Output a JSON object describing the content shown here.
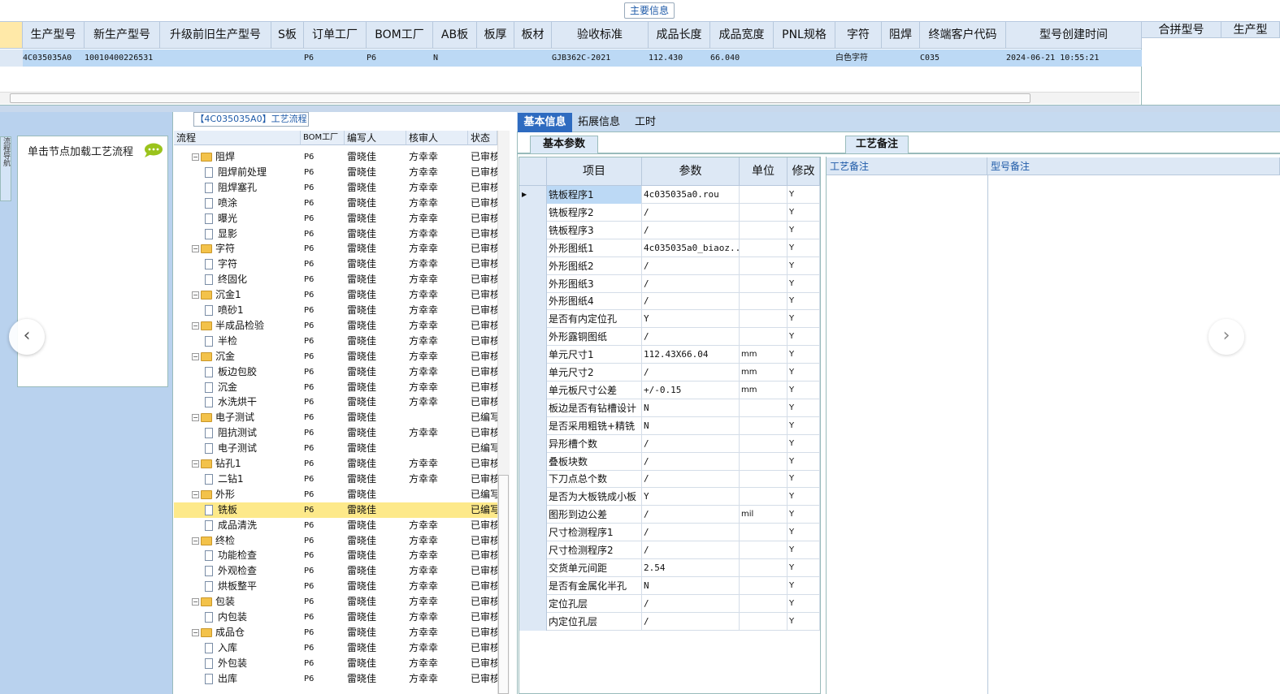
{
  "top_caption": "主要信息",
  "master": {
    "headers": [
      "生产型号",
      "新生产型号",
      "升级前旧生产型号",
      "S板",
      "订单工厂",
      "BOM工厂",
      "AB板",
      "板厚",
      "板材",
      "验收标准",
      "成品长度",
      "成品宽度",
      "PNL规格",
      "字符",
      "阻焊",
      "终端客户代码",
      "型号创建时间"
    ],
    "row": [
      "4C035035A0",
      "10010400226531",
      "",
      "",
      "P6",
      "P6",
      "N",
      "",
      "",
      "GJB362C-2021",
      "112.430",
      "66.040",
      "",
      "白色字符",
      "",
      "C035",
      "2024-06-21 10:55:21"
    ]
  },
  "merge_headers": [
    "合拼型号",
    "生产型"
  ],
  "side_tab": "流程导航",
  "node_hint": "单击节点加载工艺流程",
  "tree": {
    "title": "【4C035035A0】工艺流程",
    "headers": [
      "流程",
      "BOM工厂",
      "编写人",
      "核审人",
      "状态"
    ],
    "rows": [
      {
        "level": 0,
        "type": "folder",
        "name": "阻焊",
        "bom": "P6",
        "writer": "雷晓佳",
        "reviewer": "方幸幸",
        "status": "已审核"
      },
      {
        "level": 1,
        "type": "doc",
        "name": "阻焊前处理",
        "bom": "P6",
        "writer": "雷晓佳",
        "reviewer": "方幸幸",
        "status": "已审核"
      },
      {
        "level": 1,
        "type": "doc",
        "name": "阻焊塞孔",
        "bom": "P6",
        "writer": "雷晓佳",
        "reviewer": "方幸幸",
        "status": "已审核"
      },
      {
        "level": 1,
        "type": "doc",
        "name": "喷涂",
        "bom": "P6",
        "writer": "雷晓佳",
        "reviewer": "方幸幸",
        "status": "已审核"
      },
      {
        "level": 1,
        "type": "doc",
        "name": "曝光",
        "bom": "P6",
        "writer": "雷晓佳",
        "reviewer": "方幸幸",
        "status": "已审核"
      },
      {
        "level": 1,
        "type": "doc",
        "name": "显影",
        "bom": "P6",
        "writer": "雷晓佳",
        "reviewer": "方幸幸",
        "status": "已审核"
      },
      {
        "level": 0,
        "type": "folder",
        "name": "字符",
        "bom": "P6",
        "writer": "雷晓佳",
        "reviewer": "方幸幸",
        "status": "已审核"
      },
      {
        "level": 1,
        "type": "doc",
        "name": "字符",
        "bom": "P6",
        "writer": "雷晓佳",
        "reviewer": "方幸幸",
        "status": "已审核"
      },
      {
        "level": 1,
        "type": "doc",
        "name": "终固化",
        "bom": "P6",
        "writer": "雷晓佳",
        "reviewer": "方幸幸",
        "status": "已审核"
      },
      {
        "level": 0,
        "type": "folder",
        "name": "沉金1",
        "bom": "P6",
        "writer": "雷晓佳",
        "reviewer": "方幸幸",
        "status": "已审核"
      },
      {
        "level": 1,
        "type": "doc",
        "name": "喷砂1",
        "bom": "P6",
        "writer": "雷晓佳",
        "reviewer": "方幸幸",
        "status": "已审核"
      },
      {
        "level": 0,
        "type": "folder",
        "name": "半成品检验",
        "bom": "P6",
        "writer": "雷晓佳",
        "reviewer": "方幸幸",
        "status": "已审核"
      },
      {
        "level": 1,
        "type": "doc",
        "name": "半检",
        "bom": "P6",
        "writer": "雷晓佳",
        "reviewer": "方幸幸",
        "status": "已审核"
      },
      {
        "level": 0,
        "type": "folder",
        "name": "沉金",
        "bom": "P6",
        "writer": "雷晓佳",
        "reviewer": "方幸幸",
        "status": "已审核"
      },
      {
        "level": 1,
        "type": "doc",
        "name": "板边包胶",
        "bom": "P6",
        "writer": "雷晓佳",
        "reviewer": "方幸幸",
        "status": "已审核"
      },
      {
        "level": 1,
        "type": "doc",
        "name": "沉金",
        "bom": "P6",
        "writer": "雷晓佳",
        "reviewer": "方幸幸",
        "status": "已审核"
      },
      {
        "level": 1,
        "type": "doc",
        "name": "水洗烘干",
        "bom": "P6",
        "writer": "雷晓佳",
        "reviewer": "方幸幸",
        "status": "已审核"
      },
      {
        "level": 0,
        "type": "folder",
        "name": "电子测试",
        "bom": "P6",
        "writer": "雷晓佳",
        "reviewer": "",
        "status": "已编写"
      },
      {
        "level": 1,
        "type": "doc",
        "name": "阻抗测试",
        "bom": "P6",
        "writer": "雷晓佳",
        "reviewer": "方幸幸",
        "status": "已审核"
      },
      {
        "level": 1,
        "type": "doc",
        "name": "电子测试",
        "bom": "P6",
        "writer": "雷晓佳",
        "reviewer": "",
        "status": "已编写"
      },
      {
        "level": 0,
        "type": "folder",
        "name": "钻孔1",
        "bom": "P6",
        "writer": "雷晓佳",
        "reviewer": "方幸幸",
        "status": "已审核"
      },
      {
        "level": 1,
        "type": "doc",
        "name": "二钻1",
        "bom": "P6",
        "writer": "雷晓佳",
        "reviewer": "方幸幸",
        "status": "已审核"
      },
      {
        "level": 0,
        "type": "folder",
        "name": "外形",
        "bom": "P6",
        "writer": "雷晓佳",
        "reviewer": "",
        "status": "已编写"
      },
      {
        "level": 1,
        "type": "doc",
        "name": "铣板",
        "bom": "P6",
        "writer": "雷晓佳",
        "reviewer": "",
        "status": "已编写",
        "selected": true
      },
      {
        "level": 1,
        "type": "doc",
        "name": "成品清洗",
        "bom": "P6",
        "writer": "雷晓佳",
        "reviewer": "方幸幸",
        "status": "已审核"
      },
      {
        "level": 0,
        "type": "folder",
        "name": "终检",
        "bom": "P6",
        "writer": "雷晓佳",
        "reviewer": "方幸幸",
        "status": "已审核"
      },
      {
        "level": 1,
        "type": "doc",
        "name": "功能检查",
        "bom": "P6",
        "writer": "雷晓佳",
        "reviewer": "方幸幸",
        "status": "已审核"
      },
      {
        "level": 1,
        "type": "doc",
        "name": "外观检查",
        "bom": "P6",
        "writer": "雷晓佳",
        "reviewer": "方幸幸",
        "status": "已审核"
      },
      {
        "level": 1,
        "type": "doc",
        "name": "烘板整平",
        "bom": "P6",
        "writer": "雷晓佳",
        "reviewer": "方幸幸",
        "status": "已审核"
      },
      {
        "level": 0,
        "type": "folder",
        "name": "包装",
        "bom": "P6",
        "writer": "雷晓佳",
        "reviewer": "方幸幸",
        "status": "已审核"
      },
      {
        "level": 1,
        "type": "doc",
        "name": "内包装",
        "bom": "P6",
        "writer": "雷晓佳",
        "reviewer": "方幸幸",
        "status": "已审核"
      },
      {
        "level": 0,
        "type": "folder",
        "name": "成品仓",
        "bom": "P6",
        "writer": "雷晓佳",
        "reviewer": "方幸幸",
        "status": "已审核"
      },
      {
        "level": 1,
        "type": "doc",
        "name": "入库",
        "bom": "P6",
        "writer": "雷晓佳",
        "reviewer": "方幸幸",
        "status": "已审核"
      },
      {
        "level": 1,
        "type": "doc",
        "name": "外包装",
        "bom": "P6",
        "writer": "雷晓佳",
        "reviewer": "方幸幸",
        "status": "已审核"
      },
      {
        "level": 1,
        "type": "doc",
        "name": "出库",
        "bom": "P6",
        "writer": "雷晓佳",
        "reviewer": "方幸幸",
        "status": "已审核"
      }
    ]
  },
  "tabs": [
    "基本信息",
    "拓展信息",
    "工时"
  ],
  "basic_params_tab": "基本参数",
  "remark_tab": "工艺备注",
  "params": {
    "headers": [
      "项目",
      "参数",
      "单位",
      "修改"
    ],
    "rows": [
      {
        "item": "铣板程序1",
        "param": "4c035035a0.rou",
        "unit": "",
        "mod": "Y"
      },
      {
        "item": "铣板程序2",
        "param": "/",
        "unit": "",
        "mod": "Y"
      },
      {
        "item": "铣板程序3",
        "param": "/",
        "unit": "",
        "mod": "Y"
      },
      {
        "item": "外形图纸1",
        "param": "4c035035a0_biaoz...",
        "unit": "",
        "mod": "Y"
      },
      {
        "item": "外形图纸2",
        "param": "/",
        "unit": "",
        "mod": "Y"
      },
      {
        "item": "外形图纸3",
        "param": "/",
        "unit": "",
        "mod": "Y"
      },
      {
        "item": "外形图纸4",
        "param": "/",
        "unit": "",
        "mod": "Y"
      },
      {
        "item": "是否有内定位孔",
        "param": "Y",
        "unit": "",
        "mod": "Y"
      },
      {
        "item": "外形露铜图纸",
        "param": "/",
        "unit": "",
        "mod": "Y"
      },
      {
        "item": "单元尺寸1",
        "param": "112.43X66.04",
        "unit": "mm",
        "mod": "Y"
      },
      {
        "item": "单元尺寸2",
        "param": "/",
        "unit": "mm",
        "mod": "Y"
      },
      {
        "item": "单元板尺寸公差",
        "param": "+/-0.15",
        "unit": "mm",
        "mod": "Y"
      },
      {
        "item": "板边是否有钻槽设计",
        "param": "N",
        "unit": "",
        "mod": "Y"
      },
      {
        "item": "是否采用粗铣+精铣",
        "param": "N",
        "unit": "",
        "mod": "Y"
      },
      {
        "item": "异形槽个数",
        "param": "/",
        "unit": "",
        "mod": "Y"
      },
      {
        "item": "叠板块数",
        "param": "/",
        "unit": "",
        "mod": "Y"
      },
      {
        "item": "下刀点总个数",
        "param": "/",
        "unit": "",
        "mod": "Y"
      },
      {
        "item": "是否为大板铣成小板",
        "param": "Y",
        "unit": "",
        "mod": "Y"
      },
      {
        "item": "图形到边公差",
        "param": "/",
        "unit": "mil",
        "mod": "Y"
      },
      {
        "item": "尺寸检测程序1",
        "param": "/",
        "unit": "",
        "mod": "Y"
      },
      {
        "item": "尺寸检测程序2",
        "param": "/",
        "unit": "",
        "mod": "Y"
      },
      {
        "item": "交货单元间距",
        "param": "2.54",
        "unit": "",
        "mod": "Y"
      },
      {
        "item": "是否有金属化半孔",
        "param": "N",
        "unit": "",
        "mod": "Y"
      },
      {
        "item": "定位孔层",
        "param": "/",
        "unit": "",
        "mod": "Y"
      },
      {
        "item": "内定位孔层",
        "param": "/",
        "unit": "",
        "mod": "Y"
      }
    ]
  },
  "remarks": {
    "headers": [
      "工艺备注",
      "型号备注"
    ]
  }
}
